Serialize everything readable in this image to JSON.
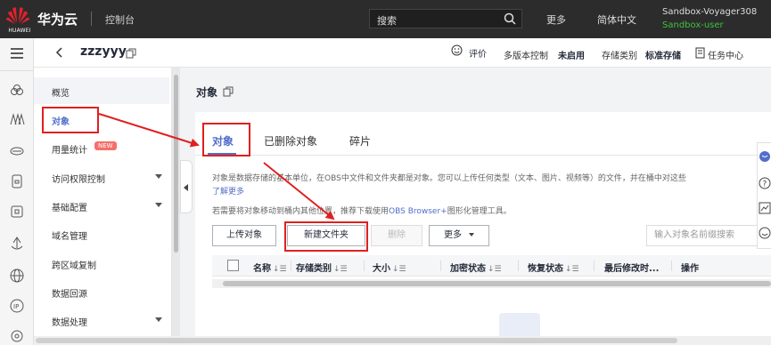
{
  "topbar": {
    "logo_text": "HUAWEI",
    "brand": "华为云",
    "console": "控制台",
    "search_placeholder": "搜索",
    "more": "更多",
    "language": "简体中文",
    "account": "Sandbox-Voyager308",
    "user": "Sandbox-user"
  },
  "rail": {
    "icons": [
      "cloud-icon",
      "servers-icon",
      "database-icon",
      "storage-icon",
      "security-icon",
      "network-icon",
      "globe-icon",
      "ip-icon",
      "settings-icon"
    ]
  },
  "subheader": {
    "bucket_name": "zzzyyy",
    "evaluate": "评价",
    "versioning_label": "多版本控制",
    "versioning_value": "未启用",
    "storage_class_label": "存储类别",
    "storage_class_value": "标准存储",
    "task_center": "任务中心"
  },
  "nav": {
    "items": [
      {
        "label": "概览"
      },
      {
        "label": "对象"
      },
      {
        "label": "用量统计",
        "badge": "NEW"
      },
      {
        "label": "访问权限控制"
      },
      {
        "label": "基础配置"
      },
      {
        "label": "域名管理"
      },
      {
        "label": "跨区域复制"
      },
      {
        "label": "数据回源"
      },
      {
        "label": "数据处理"
      }
    ]
  },
  "main": {
    "page_title": "对象",
    "tabs": [
      {
        "label": "对象"
      },
      {
        "label": "已删除对象"
      },
      {
        "label": "碎片"
      }
    ],
    "description": "对象是数据存储的基本单位，在OBS中文件和文件夹都是对象。您可以上传任何类型（文本、图片、视频等）的文件，并在桶中对这些",
    "learn_more": "了解更多",
    "hint_prefix": "若需要将对象移动到桶内其他位置，推荐下载使用",
    "hint_link": "OBS Browser+",
    "hint_suffix": "图形化管理工具。",
    "buttons": {
      "upload": "上传对象",
      "new_folder": "新建文件夹",
      "delete": "删除",
      "more": "更多"
    },
    "filter_placeholder": "输入对象名前缀搜索",
    "table": {
      "columns": [
        {
          "label": "名称",
          "sortable": true
        },
        {
          "label": "存储类别",
          "sortable": true
        },
        {
          "label": "大小",
          "sortable": true
        },
        {
          "label": "加密状态",
          "sortable": true
        },
        {
          "label": "恢复状态",
          "sortable": true
        },
        {
          "label": "最后修改时...",
          "sortable": false
        },
        {
          "label": "操作",
          "sortable": false
        }
      ],
      "sort_glyph": "↓☰"
    }
  },
  "colors": {
    "topbar_bg": "#2c2c2c",
    "accent": "#526ecc",
    "annotation": "#e02020",
    "user_green": "#3ec23e",
    "badge_red": "#f66f6a"
  }
}
